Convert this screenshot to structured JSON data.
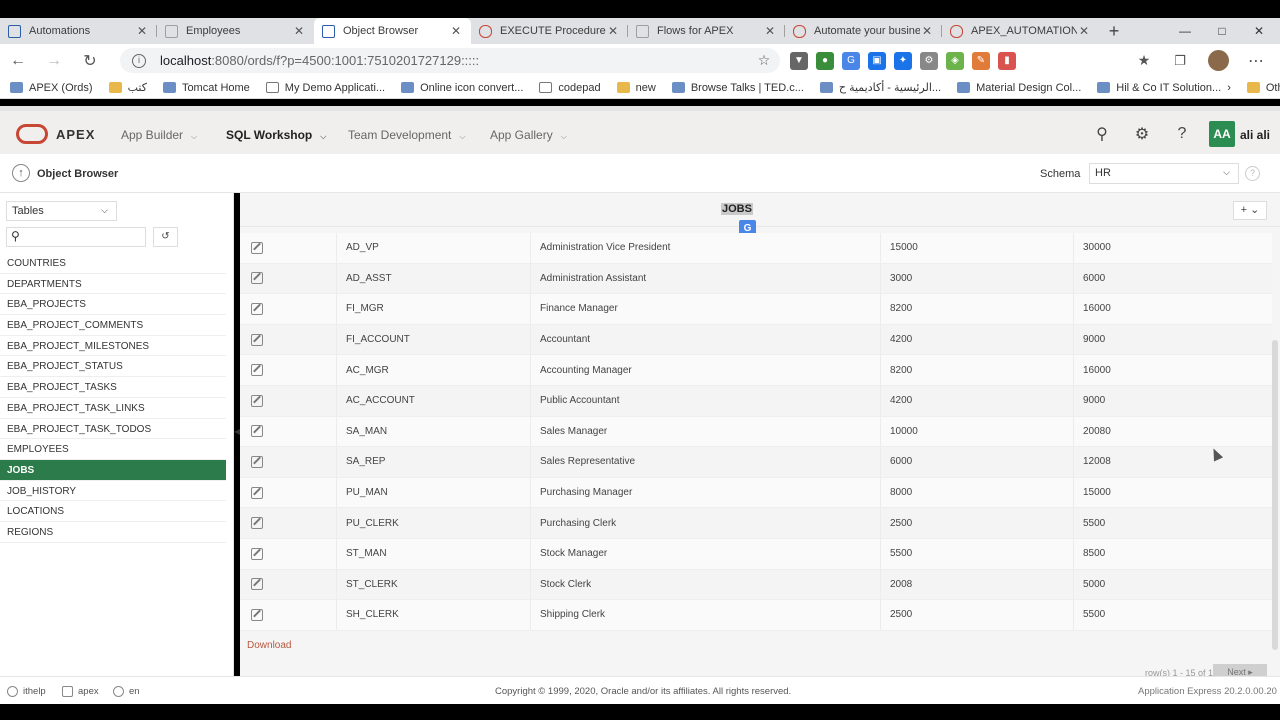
{
  "browser": {
    "tabs": [
      {
        "title": "Automations",
        "color": "#2b5da8"
      },
      {
        "title": "Employees",
        "color": "#9aa0a6"
      },
      {
        "title": "Object Browser",
        "color": "#2b5da8"
      },
      {
        "title": "EXECUTE Procedure",
        "color": "#c74634"
      },
      {
        "title": "Flows for APEX",
        "color": "#9aa0a6"
      },
      {
        "title": "Automate your busine",
        "color": "#c74634"
      },
      {
        "title": "APEX_AUTOMATION",
        "color": "#c74634"
      }
    ],
    "url_host": "localhost",
    "url_rest": ":8080/ords/f?p=4500:1001:7510201727129:::::",
    "bookmarks": [
      {
        "label": "APEX (Ords)",
        "kind": "site"
      },
      {
        "label": "كتب",
        "kind": "folder"
      },
      {
        "label": "Tomcat Home",
        "kind": "site"
      },
      {
        "label": "My Demo Applicati...",
        "kind": "page"
      },
      {
        "label": "Online icon convert...",
        "kind": "site"
      },
      {
        "label": "codepad",
        "kind": "page"
      },
      {
        "label": "new",
        "kind": "folder"
      },
      {
        "label": "Browse Talks | TED.c...",
        "kind": "site"
      },
      {
        "label": "الرئيسية - أكاديمية ح...",
        "kind": "site"
      },
      {
        "label": "Material Design Col...",
        "kind": "site"
      },
      {
        "label": "Hil & Co IT Solution...",
        "kind": "site"
      }
    ],
    "other_favorites": "Other favorites"
  },
  "apex": {
    "brand": "APEX",
    "menus": [
      {
        "label": "App Builder",
        "active": false
      },
      {
        "label": "SQL Workshop",
        "active": true
      },
      {
        "label": "Team Development",
        "active": false
      },
      {
        "label": "App Gallery",
        "active": false
      }
    ],
    "avatar_initials": "AA",
    "username": "ali ali",
    "accent": "#c74634",
    "selected_color": "#2c7b4b"
  },
  "object_browser": {
    "title": "Object Browser",
    "schema_label": "Schema",
    "schema_value": "HR",
    "object_type": "Tables",
    "objects": [
      "COUNTRIES",
      "DEPARTMENTS",
      "EBA_PROJECTS",
      "EBA_PROJECT_COMMENTS",
      "EBA_PROJECT_MILESTONES",
      "EBA_PROJECT_STATUS",
      "EBA_PROJECT_TASKS",
      "EBA_PROJECT_TASK_LINKS",
      "EBA_PROJECT_TASK_TODOS",
      "EMPLOYEES",
      "JOBS",
      "JOB_HISTORY",
      "LOCATIONS",
      "REGIONS"
    ],
    "selected": "JOBS"
  },
  "table": {
    "title": "JOBS",
    "plus_label": "+ ⌄",
    "rows": [
      [
        "AD_VP",
        "Administration Vice President",
        "15000",
        "30000"
      ],
      [
        "AD_ASST",
        "Administration Assistant",
        "3000",
        "6000"
      ],
      [
        "FI_MGR",
        "Finance Manager",
        "8200",
        "16000"
      ],
      [
        "FI_ACCOUNT",
        "Accountant",
        "4200",
        "9000"
      ],
      [
        "AC_MGR",
        "Accounting Manager",
        "8200",
        "16000"
      ],
      [
        "AC_ACCOUNT",
        "Public Accountant",
        "4200",
        "9000"
      ],
      [
        "SA_MAN",
        "Sales Manager",
        "10000",
        "20080"
      ],
      [
        "SA_REP",
        "Sales Representative",
        "6000",
        "12008"
      ],
      [
        "PU_MAN",
        "Purchasing Manager",
        "8000",
        "15000"
      ],
      [
        "PU_CLERK",
        "Purchasing Clerk",
        "2500",
        "5500"
      ],
      [
        "ST_MAN",
        "Stock Manager",
        "5500",
        "8500"
      ],
      [
        "ST_CLERK",
        "Stock Clerk",
        "2008",
        "5000"
      ],
      [
        "SH_CLERK",
        "Shipping Clerk",
        "2500",
        "5500"
      ]
    ],
    "download": "Download",
    "pagination": "row(s) 1 - 15 of 19",
    "next": "Next ▸"
  },
  "footer": {
    "user": "ithelp",
    "workspace": "apex",
    "language": "en",
    "copyright": "Copyright © 1999, 2020, Oracle and/or its affiliates. All rights reserved.",
    "version": "Application Express 20.2.0.00.20"
  }
}
